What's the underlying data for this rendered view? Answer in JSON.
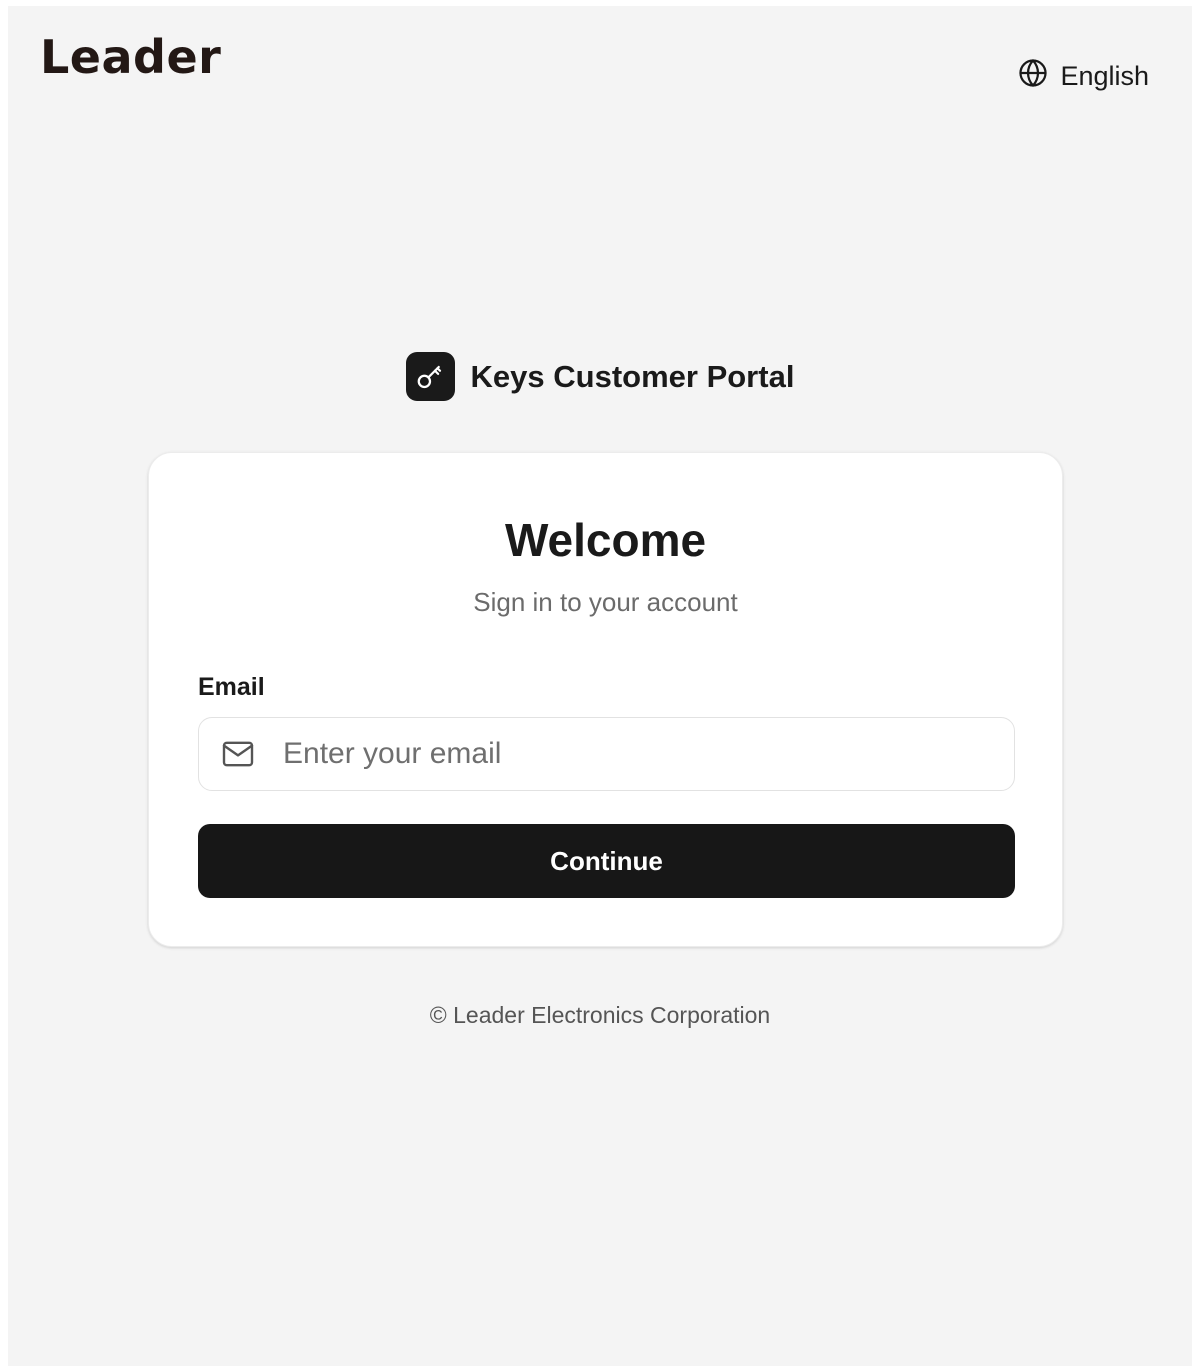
{
  "header": {
    "logo_text": "Leader",
    "language_label": "English",
    "language_icon": "globe-icon"
  },
  "brand": {
    "icon": "key-icon",
    "title": "Keys Customer Portal"
  },
  "login_card": {
    "title": "Welcome",
    "subtitle": "Sign in to your account",
    "email_label": "Email",
    "email_placeholder": "Enter your email",
    "email_value": "",
    "email_icon": "mail-icon",
    "continue_label": "Continue"
  },
  "footer": {
    "copyright": "© Leader Electronics Corporation"
  },
  "colors": {
    "page_background": "#f4f4f4",
    "card_background": "#ffffff",
    "primary_button": "#171717",
    "text_primary": "#1a1a1a",
    "text_muted": "#6b6b6b"
  }
}
